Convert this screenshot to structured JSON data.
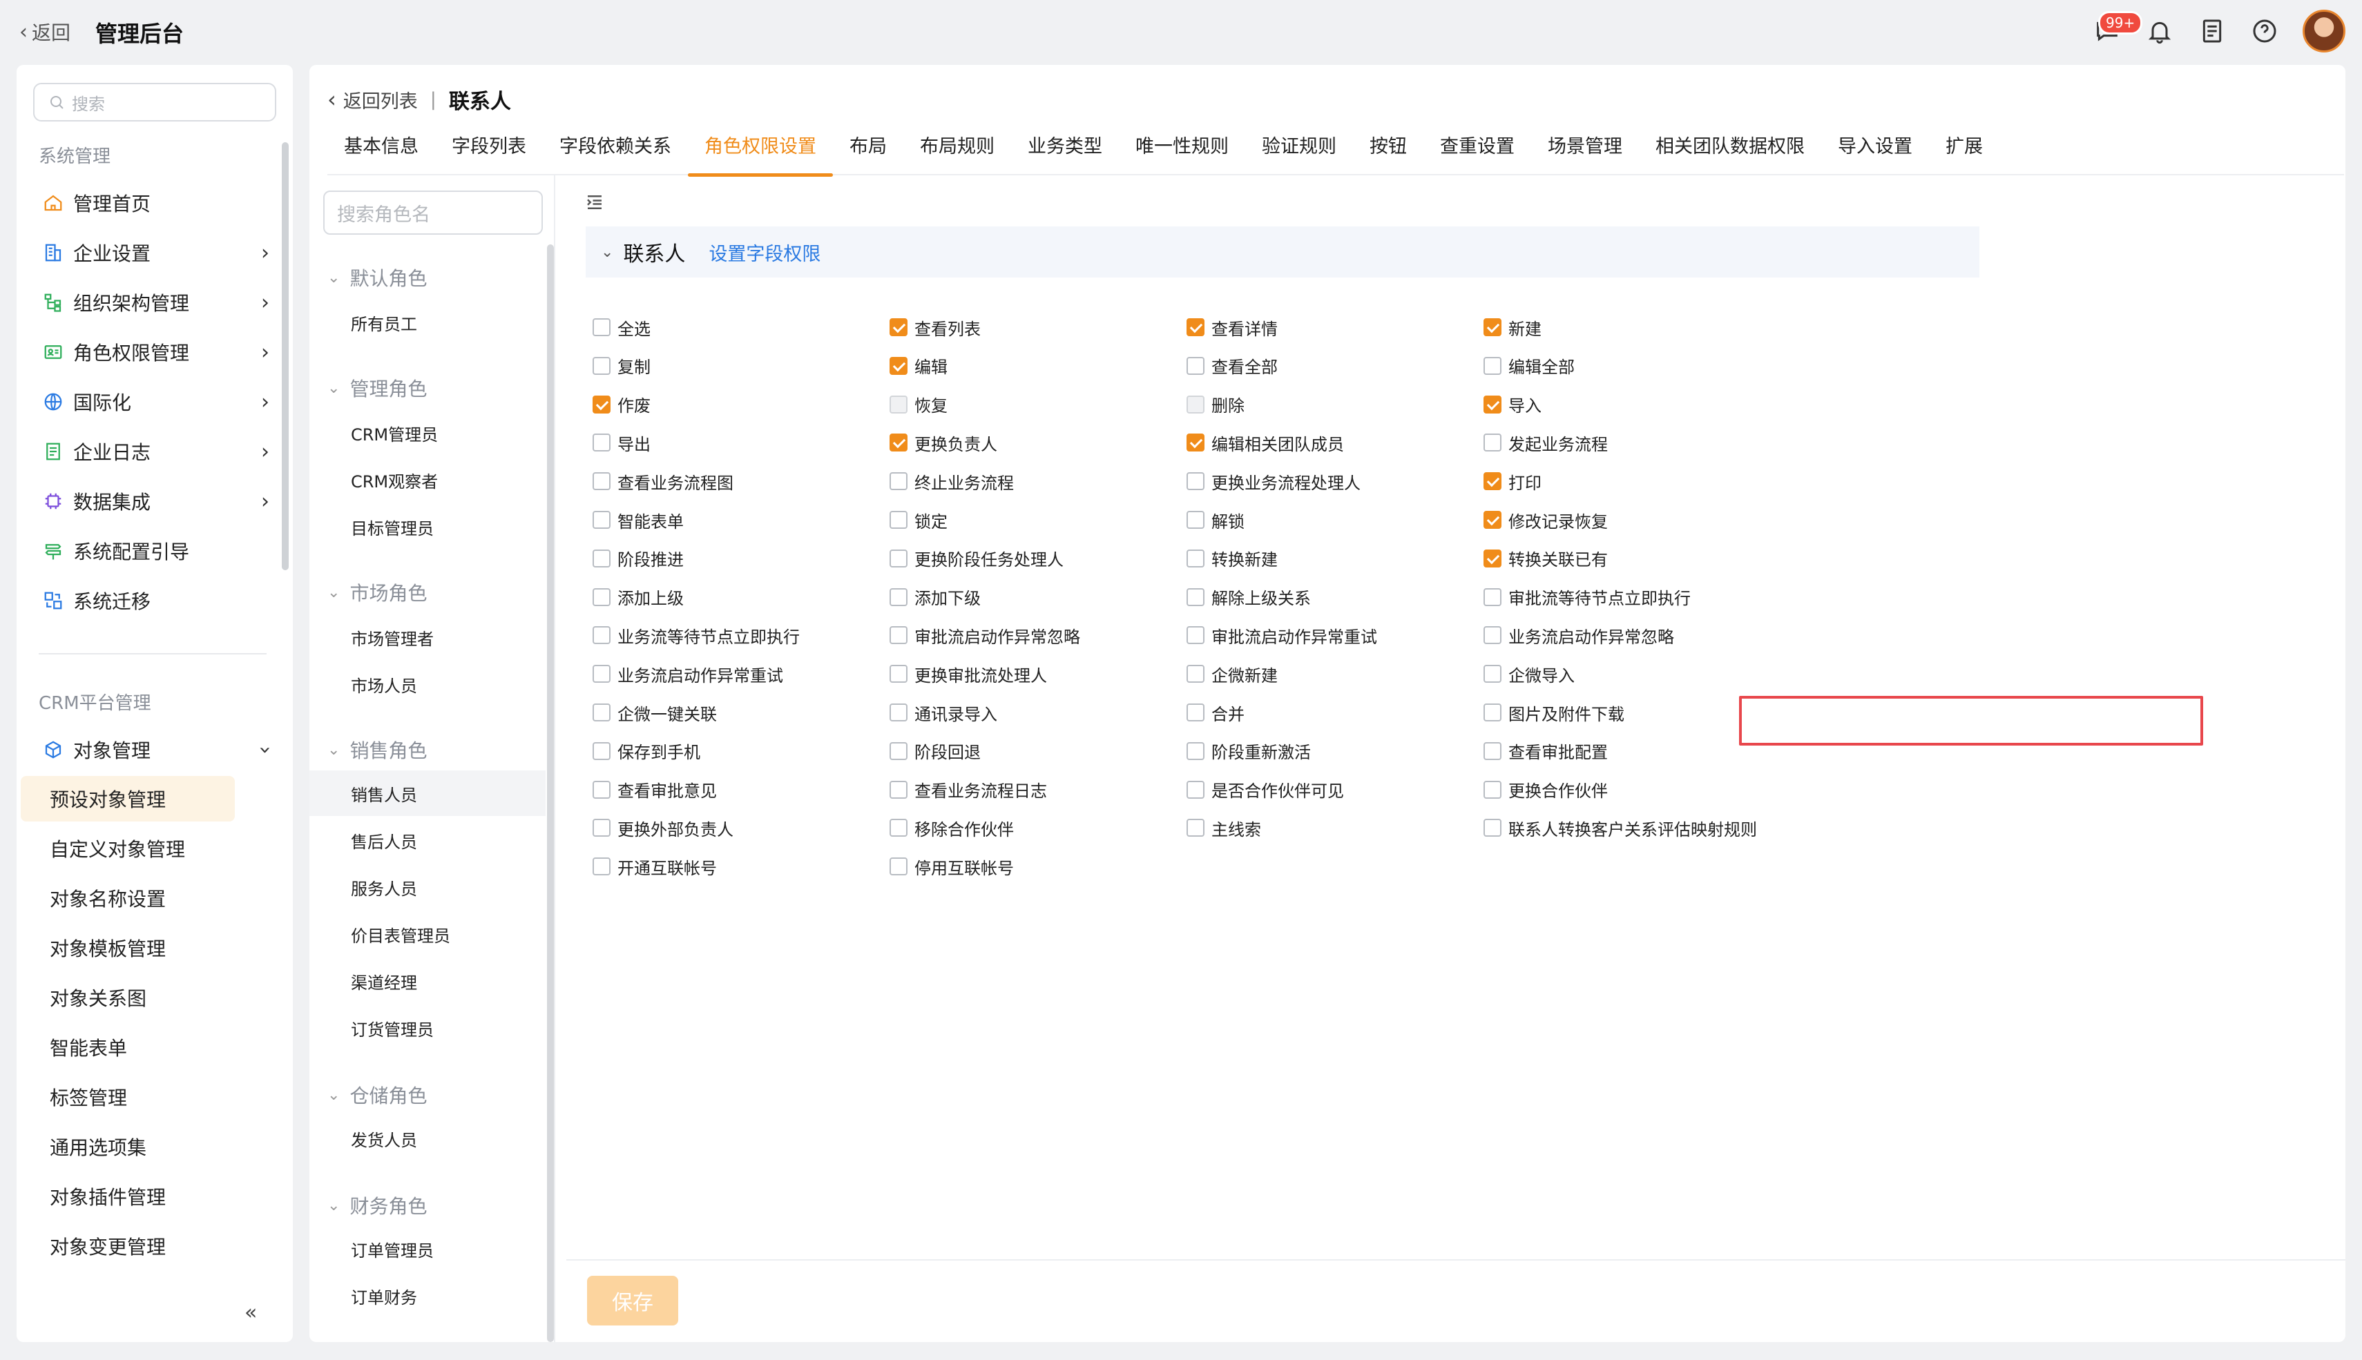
{
  "topbar": {
    "back_label": "返回",
    "title": "管理后台",
    "badge_count": "99+",
    "icons": [
      "chat-icon",
      "bell-icon",
      "notes-icon",
      "help-icon",
      "avatar"
    ]
  },
  "sidebar": {
    "search_placeholder": "搜索",
    "group1": "系统管理",
    "items": [
      {
        "label": "管理首页",
        "icon": "home-icon",
        "arrow": false
      },
      {
        "label": "企业设置",
        "icon": "building-icon",
        "arrow": true
      },
      {
        "label": "组织架构管理",
        "icon": "org-tree-icon",
        "arrow": true
      },
      {
        "label": "角色权限管理",
        "icon": "id-card-icon",
        "arrow": true
      },
      {
        "label": "国际化",
        "icon": "globe-icon",
        "arrow": true
      },
      {
        "label": "企业日志",
        "icon": "log-icon",
        "arrow": true
      },
      {
        "label": "数据集成",
        "icon": "chip-icon",
        "arrow": true
      },
      {
        "label": "系统配置引导",
        "icon": "signpost-icon",
        "arrow": false
      },
      {
        "label": "系统迁移",
        "icon": "migrate-icon",
        "arrow": false
      }
    ],
    "group2": "CRM平台管理",
    "object_mgmt": "对象管理",
    "sub_items": [
      "预设对象管理",
      "自定义对象管理",
      "对象名称设置",
      "对象模板管理",
      "对象关系图",
      "智能表单",
      "标签管理",
      "通用选项集",
      "对象插件管理",
      "对象变更管理"
    ],
    "active_sub": "预设对象管理"
  },
  "main": {
    "back_list": "返回列表",
    "object_name": "联系人",
    "tabs": [
      "基本信息",
      "字段列表",
      "字段依赖关系",
      "角色权限设置",
      "布局",
      "布局规则",
      "业务类型",
      "唯一性规则",
      "验证规则",
      "按钮",
      "查重设置",
      "场景管理",
      "相关团队数据权限",
      "导入设置",
      "扩展"
    ],
    "active_tab": "角色权限设置"
  },
  "roles": {
    "search_placeholder": "搜索角色名",
    "groups": [
      {
        "title": "默认角色",
        "items": [
          "所有员工"
        ]
      },
      {
        "title": "管理角色",
        "items": [
          "CRM管理员",
          "CRM观察者",
          "目标管理员"
        ]
      },
      {
        "title": "市场角色",
        "items": [
          "市场管理者",
          "市场人员"
        ]
      },
      {
        "title": "销售角色",
        "items": [
          "销售人员",
          "售后人员",
          "服务人员",
          "价目表管理员",
          "渠道经理",
          "订货管理员"
        ]
      },
      {
        "title": "仓储角色",
        "items": [
          "发货人员"
        ]
      },
      {
        "title": "财务角色",
        "items": [
          "订单管理员",
          "订单财务"
        ]
      }
    ],
    "active_role": "销售人员"
  },
  "permissions": {
    "section_title": "联系人",
    "field_perm_link": "设置字段权限",
    "rows": [
      [
        {
          "l": "全选",
          "s": "off"
        },
        {
          "l": "查看列表",
          "s": "on"
        },
        {
          "l": "查看详情",
          "s": "on"
        },
        {
          "l": "新建",
          "s": "on"
        }
      ],
      [
        {
          "l": "复制",
          "s": "off"
        },
        {
          "l": "编辑",
          "s": "on"
        },
        {
          "l": "查看全部",
          "s": "off"
        },
        {
          "l": "编辑全部",
          "s": "off"
        }
      ],
      [
        {
          "l": "作废",
          "s": "on"
        },
        {
          "l": "恢复",
          "s": "dis"
        },
        {
          "l": "删除",
          "s": "dis"
        },
        {
          "l": "导入",
          "s": "on"
        }
      ],
      [
        {
          "l": "导出",
          "s": "off"
        },
        {
          "l": "更换负责人",
          "s": "on"
        },
        {
          "l": "编辑相关团队成员",
          "s": "on"
        },
        {
          "l": "发起业务流程",
          "s": "off"
        }
      ],
      [
        {
          "l": "查看业务流程图",
          "s": "off"
        },
        {
          "l": "终止业务流程",
          "s": "off"
        },
        {
          "l": "更换业务流程处理人",
          "s": "off"
        },
        {
          "l": "打印",
          "s": "on"
        }
      ],
      [
        {
          "l": "智能表单",
          "s": "off"
        },
        {
          "l": "锁定",
          "s": "off"
        },
        {
          "l": "解锁",
          "s": "off"
        },
        {
          "l": "修改记录恢复",
          "s": "on"
        }
      ],
      [
        {
          "l": "阶段推进",
          "s": "off"
        },
        {
          "l": "更换阶段任务处理人",
          "s": "off"
        },
        {
          "l": "转换新建",
          "s": "off"
        },
        {
          "l": "转换关联已有",
          "s": "on"
        }
      ],
      [
        {
          "l": "添加上级",
          "s": "off"
        },
        {
          "l": "添加下级",
          "s": "off"
        },
        {
          "l": "解除上级关系",
          "s": "off"
        },
        {
          "l": "审批流等待节点立即执行",
          "s": "off"
        }
      ],
      [
        {
          "l": "业务流等待节点立即执行",
          "s": "off"
        },
        {
          "l": "审批流启动作异常忽略",
          "s": "off"
        },
        {
          "l": "审批流启动作异常重试",
          "s": "off"
        },
        {
          "l": "业务流启动作异常忽略",
          "s": "off"
        }
      ],
      [
        {
          "l": "业务流启动作异常重试",
          "s": "off"
        },
        {
          "l": "更换审批流处理人",
          "s": "off"
        },
        {
          "l": "企微新建",
          "s": "off"
        },
        {
          "l": "企微导入",
          "s": "off"
        }
      ],
      [
        {
          "l": "企微一键关联",
          "s": "off"
        },
        {
          "l": "通讯录导入",
          "s": "off"
        },
        {
          "l": "合并",
          "s": "off"
        },
        {
          "l": "图片及附件下载",
          "s": "off"
        }
      ],
      [
        {
          "l": "保存到手机",
          "s": "off"
        },
        {
          "l": "阶段回退",
          "s": "off"
        },
        {
          "l": "阶段重新激活",
          "s": "off"
        },
        {
          "l": "查看审批配置",
          "s": "off"
        }
      ],
      [
        {
          "l": "查看审批意见",
          "s": "off"
        },
        {
          "l": "查看业务流程日志",
          "s": "off"
        },
        {
          "l": "是否合作伙伴可见",
          "s": "off"
        },
        {
          "l": "更换合作伙伴",
          "s": "off"
        }
      ],
      [
        {
          "l": "更换外部负责人",
          "s": "off"
        },
        {
          "l": "移除合作伙伴",
          "s": "off"
        },
        {
          "l": "主线索",
          "s": "off"
        },
        {
          "l": "联系人转换客户关系评估映射规则",
          "s": "off"
        }
      ],
      [
        {
          "l": "开通互联帐号",
          "s": "off"
        },
        {
          "l": "停用互联帐号",
          "s": "off"
        }
      ]
    ]
  },
  "footer": {
    "save_label": "保存"
  },
  "colors": {
    "accent": "#f08c1a",
    "link": "#2a7ae2",
    "highlight": "#e8474c",
    "badge": "#f04a3e"
  }
}
